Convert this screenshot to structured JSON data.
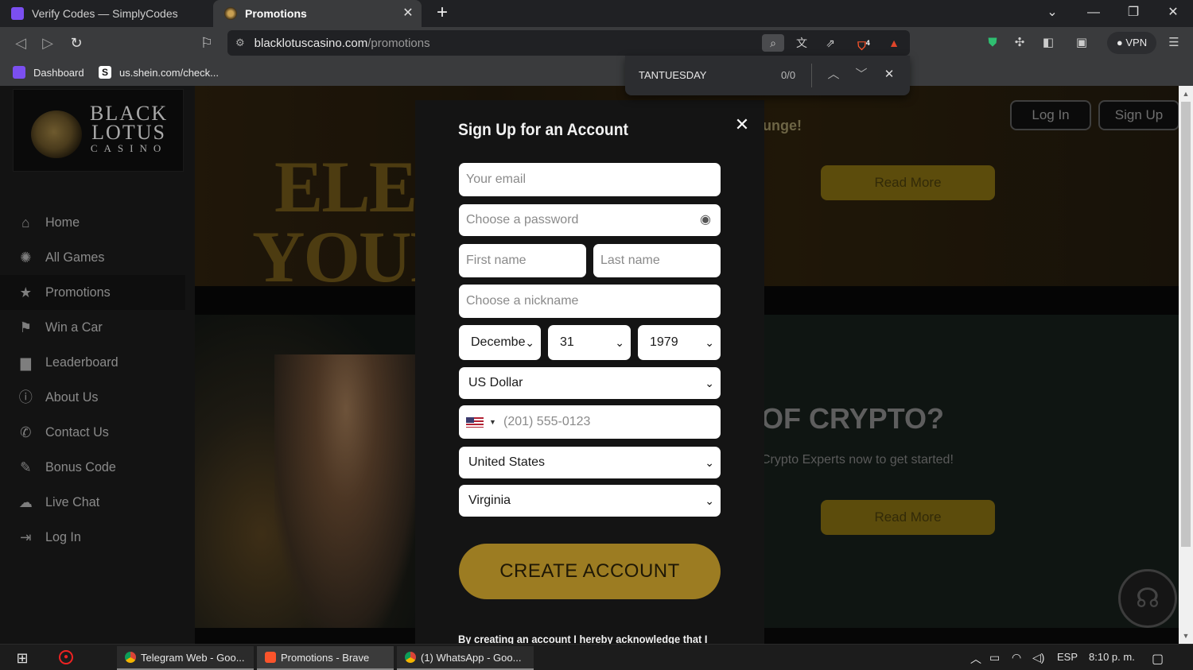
{
  "browser": {
    "tabs": [
      {
        "title": "Verify Codes — SimplyCodes",
        "active": false
      },
      {
        "title": "Promotions",
        "active": true
      }
    ],
    "url_host": "blacklotuscasino.com",
    "url_path": "/promotions",
    "shield_count": "4",
    "vpn_label": "VPN",
    "bookmarks": [
      {
        "label": "Dashboard"
      },
      {
        "label": "us.shein.com/check..."
      }
    ],
    "find": {
      "query": "TANTUESDAY",
      "count": "0/0"
    }
  },
  "site": {
    "logo": {
      "line1": "BLACK",
      "line2": "LOTUS",
      "line3": "CASINO"
    },
    "nav": [
      {
        "label": "Home",
        "icon": "home-icon",
        "glyph": "⌂"
      },
      {
        "label": "All Games",
        "icon": "games-icon",
        "glyph": "✺"
      },
      {
        "label": "Promotions",
        "icon": "star-icon",
        "glyph": "★"
      },
      {
        "label": "Win a Car",
        "icon": "car-icon",
        "glyph": "⚑"
      },
      {
        "label": "Leaderboard",
        "icon": "leaderboard-icon",
        "glyph": "▆"
      },
      {
        "label": "About Us",
        "icon": "info-icon",
        "glyph": "ⓘ"
      },
      {
        "label": "Contact Us",
        "icon": "phone-icon",
        "glyph": "✆"
      },
      {
        "label": "Bonus Code",
        "icon": "tag-icon",
        "glyph": "✎"
      },
      {
        "label": "Live Chat",
        "icon": "chat-icon",
        "glyph": "☁"
      },
      {
        "label": "Log In",
        "icon": "login-icon",
        "glyph": "⇥"
      }
    ],
    "header": {
      "login_label": "Log In",
      "signup_label": "Sign Up"
    },
    "banner1": {
      "headline_1": "ELEV",
      "headline_2": "YOUR",
      "tagline": "unge!",
      "cta": "Read More"
    },
    "banner2": {
      "headline": "OF CRYPTO?",
      "subtext": "Crypto Experts now to get started!",
      "cta": "Read More"
    }
  },
  "modal": {
    "title": "Sign Up for an Account",
    "email_placeholder": "Your email",
    "password_placeholder": "Choose a password",
    "first_name_placeholder": "First name",
    "last_name_placeholder": "Last name",
    "nickname_placeholder": "Choose a nickname",
    "dob_month": "Decembe",
    "dob_day": "31",
    "dob_year": "1979",
    "currency": "US Dollar",
    "phone_placeholder": "(201) 555-0123",
    "country": "United States",
    "state": "Virginia",
    "submit_label": "CREATE ACCOUNT",
    "legal_text": "By creating an account I hereby acknowledge that I"
  },
  "taskbar": {
    "apps": [
      {
        "label": "Telegram Web - Goo...",
        "icon": "chrome-icon"
      },
      {
        "label": "Promotions - Brave",
        "icon": "brave-icon"
      },
      {
        "label": "(1) WhatsApp - Goo...",
        "icon": "chrome-icon"
      }
    ],
    "language": "ESP",
    "clock": "8:10 p. m."
  },
  "colors": {
    "accent_gold": "#9c7c22",
    "modal_bg": "#141414",
    "page_bg": "#0b0b0b"
  }
}
